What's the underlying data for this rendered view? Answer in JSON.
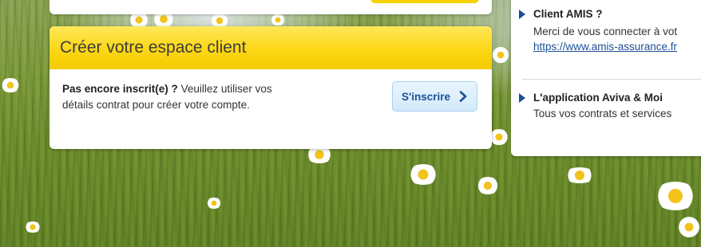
{
  "create_account": {
    "title": "Créer votre espace client",
    "text_bold": "Pas encore inscrit(e) ?",
    "text_rest": " Veuillez utiliser vos détails contrat pour créer votre compte.",
    "button_label": "S'inscrire",
    "button_icon": "chevron-right-icon"
  },
  "right_panel": {
    "items": [
      {
        "title": "Client AMIS ?",
        "text": "Merci de vous connecter à vot",
        "link": "https://www.amis-assurance.fr"
      },
      {
        "title": "L'application Aviva & Moi",
        "text": "Tous vos contrats et services"
      }
    ]
  },
  "colors": {
    "accent_yellow": "#f7d200",
    "link_blue": "#1e4f96",
    "button_bg": "#d3eafa"
  }
}
